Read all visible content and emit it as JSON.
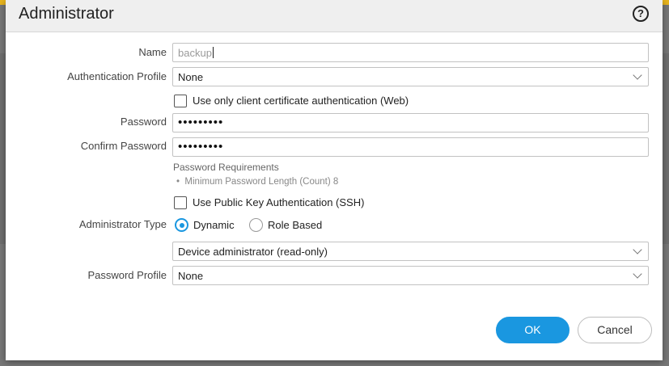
{
  "dialog": {
    "title": "Administrator",
    "help_icon": "help-circle-icon"
  },
  "form": {
    "name": {
      "label": "Name",
      "value": "backup"
    },
    "auth_profile": {
      "label": "Authentication Profile",
      "value": "None"
    },
    "client_cert": {
      "label": "Use only client certificate authentication (Web)",
      "checked": false
    },
    "password": {
      "label": "Password",
      "masked": "•••••••••"
    },
    "confirm_password": {
      "label": "Confirm Password",
      "masked": "•••••••••"
    },
    "password_requirements": {
      "title": "Password Requirements",
      "items": [
        "Minimum Password Length (Count) 8"
      ]
    },
    "public_key": {
      "label": "Use Public Key Authentication (SSH)",
      "checked": false
    },
    "admin_type": {
      "label": "Administrator Type",
      "options": [
        "Dynamic",
        "Role Based"
      ],
      "selected": "Dynamic",
      "role_value": "Device administrator (read-only)"
    },
    "password_profile": {
      "label": "Password Profile",
      "value": "None"
    }
  },
  "buttons": {
    "ok": "OK",
    "cancel": "Cancel"
  },
  "colors": {
    "accent": "#1a97e0",
    "header_bg": "#efefef",
    "backdrop": "#777777",
    "topbar": "#e7b41e"
  }
}
